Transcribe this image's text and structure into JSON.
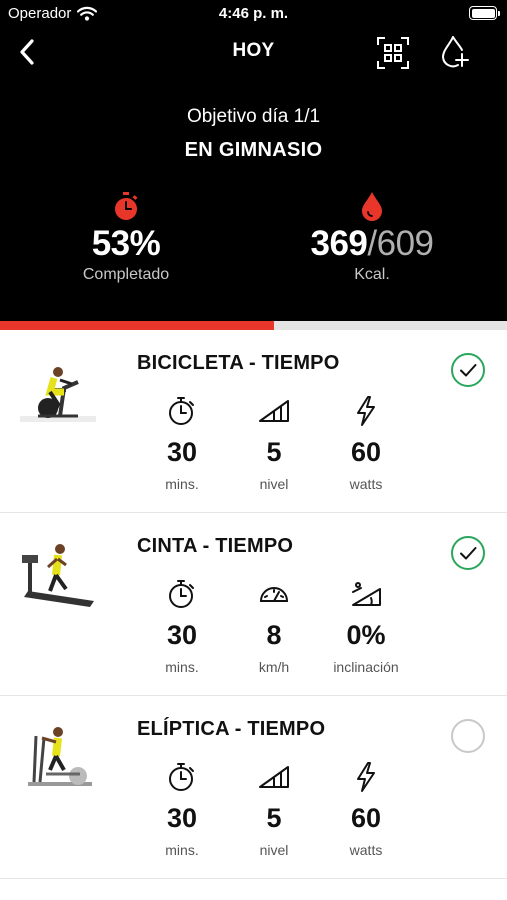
{
  "status_bar": {
    "carrier": "Operador",
    "time": "4:46 p. m."
  },
  "nav": {
    "title": "HOY"
  },
  "goal": {
    "subtitle": "Objetivo día 1/1",
    "title": "EN GIMNASIO"
  },
  "stats": {
    "completed": {
      "value": "53%",
      "label": "Completado"
    },
    "kcal": {
      "value": "369",
      "total": "/609",
      "label": "Kcal."
    }
  },
  "progress": {
    "fraction": 0.54
  },
  "colors": {
    "accent": "#e8362b",
    "check": "#2aa65c",
    "header_bg": "#000000"
  },
  "exercises": [
    {
      "name": "BICICLETA - TIEMPO",
      "image": "bike-icon",
      "done": true,
      "metrics": [
        {
          "icon": "stopwatch-icon",
          "value": "30",
          "unit": "mins."
        },
        {
          "icon": "level-icon",
          "value": "5",
          "unit": "nivel"
        },
        {
          "icon": "lightning-icon",
          "value": "60",
          "unit": "watts"
        }
      ]
    },
    {
      "name": "CINTA - TIEMPO",
      "image": "treadmill-icon",
      "done": true,
      "metrics": [
        {
          "icon": "stopwatch-icon",
          "value": "30",
          "unit": "mins."
        },
        {
          "icon": "speedometer-icon",
          "value": "8",
          "unit": "km/h"
        },
        {
          "icon": "incline-icon",
          "value": "0%",
          "unit": "inclinación"
        }
      ]
    },
    {
      "name": "ELÍPTICA - TIEMPO",
      "image": "elliptical-icon",
      "done": false,
      "metrics": [
        {
          "icon": "stopwatch-icon",
          "value": "30",
          "unit": "mins."
        },
        {
          "icon": "level-icon",
          "value": "5",
          "unit": "nivel"
        },
        {
          "icon": "lightning-icon",
          "value": "60",
          "unit": "watts"
        }
      ]
    }
  ]
}
